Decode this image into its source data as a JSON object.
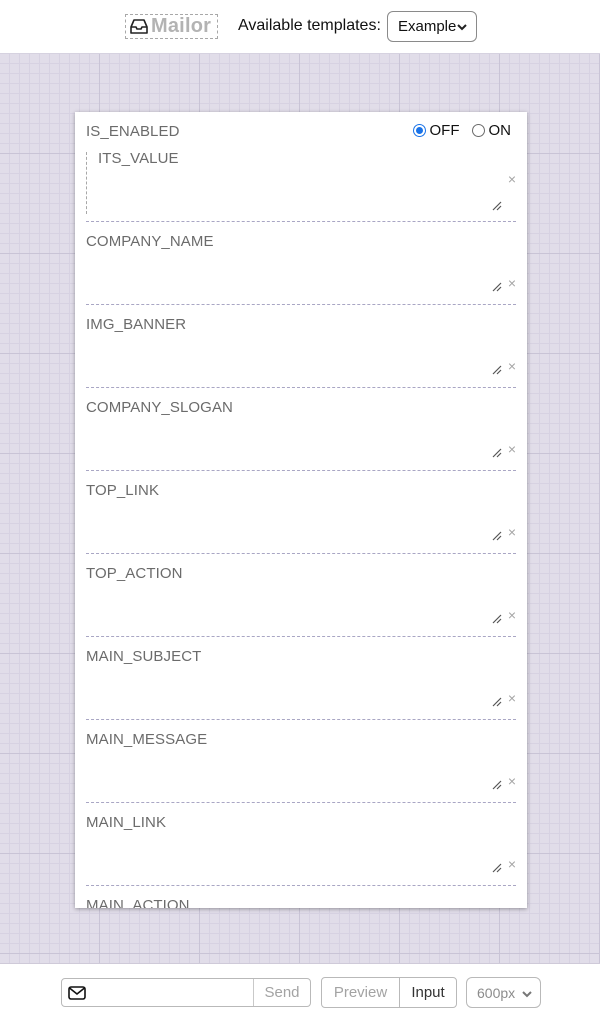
{
  "header": {
    "logo_text": "Mailor",
    "templates_label": "Available templates:",
    "template_selected": "Example"
  },
  "form": {
    "toggle": {
      "label": "IS_ENABLED",
      "off_label": "OFF",
      "on_label": "ON",
      "selected": "OFF",
      "nested_label": "ITS_VALUE"
    },
    "fields": [
      {
        "label": "COMPANY_NAME"
      },
      {
        "label": "IMG_BANNER"
      },
      {
        "label": "COMPANY_SLOGAN"
      },
      {
        "label": "TOP_LINK"
      },
      {
        "label": "TOP_ACTION"
      },
      {
        "label": "MAIN_SUBJECT"
      },
      {
        "label": "MAIN_MESSAGE"
      },
      {
        "label": "MAIN_LINK"
      },
      {
        "label": "MAIN_ACTION"
      }
    ],
    "clear_symbol": "×"
  },
  "footer": {
    "email_value": "",
    "send_label": "Send",
    "preview_label": "Preview",
    "input_label": "Input",
    "width_selected": "600px"
  },
  "icons": {
    "logo": "inbox-icon",
    "email": "envelope-icon",
    "clear": "close-icon",
    "resize": "resize-handle-icon",
    "dropdown": "chevron-down-icon"
  },
  "colors": {
    "canvas": "#e1dde9",
    "radio_accent": "#1a73e8",
    "label": "#6b6b6b"
  }
}
